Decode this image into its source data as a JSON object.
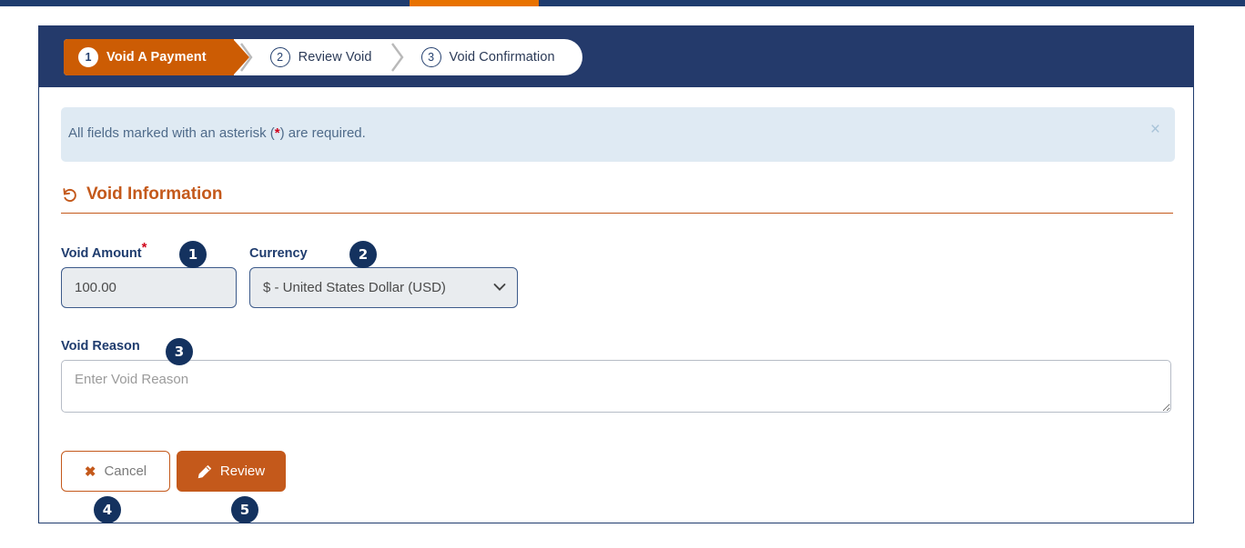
{
  "theme": {
    "navy": "#243a6b",
    "orange": "#cc5c04",
    "alert_bg": "#dfeaf3",
    "required_red": "#d0021b",
    "badge_navy": "#14325f"
  },
  "stepper": {
    "steps": [
      {
        "num": "1",
        "label": "Void A Payment",
        "state": "active"
      },
      {
        "num": "2",
        "label": "Review Void",
        "state": "upcoming"
      },
      {
        "num": "3",
        "label": "Void Confirmation",
        "state": "upcoming"
      }
    ]
  },
  "alert": {
    "text_before": "All fields marked with an asterisk (",
    "asterisk": "*",
    "text_after": ") are required.",
    "close_icon": "close-icon",
    "close_glyph": "×"
  },
  "section": {
    "icon": "undo-arrow-icon",
    "title": "Void Information"
  },
  "form": {
    "amount": {
      "label": "Void Amount",
      "required_marker": "*",
      "value": "100.00"
    },
    "currency": {
      "label": "Currency",
      "value": "$ - United States Dollar (USD)",
      "options": [
        "$ - United States Dollar (USD)"
      ],
      "chevron_icon": "chevron-down-icon"
    },
    "reason": {
      "label": "Void Reason",
      "value": "",
      "placeholder": "Enter Void Reason"
    }
  },
  "actions": {
    "cancel": {
      "label": "Cancel",
      "icon": "close-x-icon",
      "glyph": "✖"
    },
    "review": {
      "label": "Review",
      "icon": "pencil-icon"
    }
  },
  "annotations": [
    {
      "num": "1",
      "target": "void-amount-field"
    },
    {
      "num": "2",
      "target": "currency-select"
    },
    {
      "num": "3",
      "target": "void-reason-field"
    },
    {
      "num": "4",
      "target": "cancel-button"
    },
    {
      "num": "5",
      "target": "review-button"
    }
  ]
}
